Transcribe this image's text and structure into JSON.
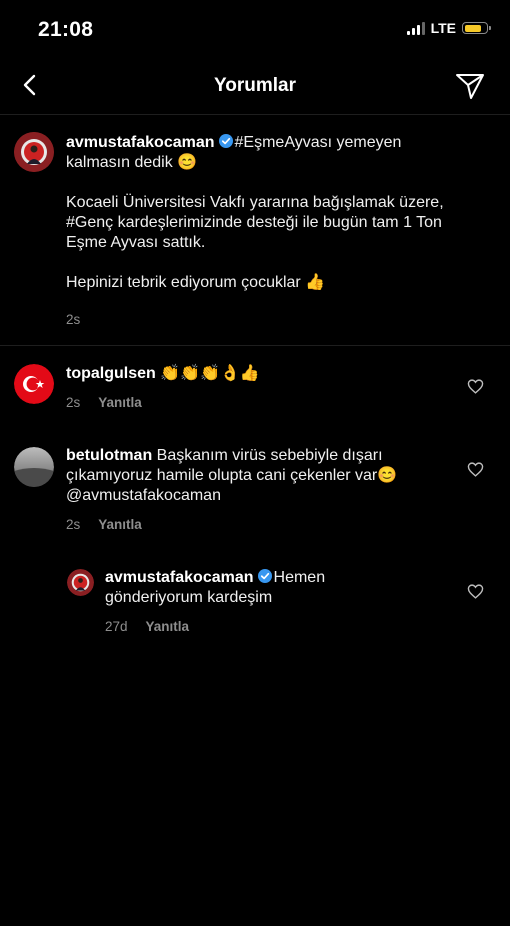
{
  "status_bar": {
    "time": "21:08",
    "network": "LTE"
  },
  "header": {
    "title": "Yorumlar"
  },
  "caption": {
    "username": "avmustafakocaman",
    "line1_rest": "#EşmeAyvası yemeyen",
    "line2": "kalmasın dedik 😊",
    "para2_line1": "Kocaeli Üniversitesi Vakfı yararına bağışlamak üzere,",
    "para2_line2": "#Genç kardeşlerimizinde desteği ile bugün tam 1 Ton",
    "para2_line3": "Eşme Ayvası sattık.",
    "para3": "Hepinizi tebrik ediyorum çocuklar 👍",
    "time": "2s"
  },
  "comments": [
    {
      "username": "topalgulsen",
      "text": "👏👏👏👌👍",
      "time": "2s",
      "reply_label": "Yanıtla"
    },
    {
      "username": "betulotman",
      "line1_rest": "Başkanım virüs sebebiyle dışarı",
      "line2": "çıkamıyoruz hamile olupta cani çekenler var😊",
      "line3": "@avmustafakocaman",
      "time": "2s",
      "reply_label": "Yanıtla"
    }
  ],
  "reply": {
    "username": "avmustafakocaman",
    "line1_rest": "Hemen",
    "line2": "gönderiyorum kardeşim",
    "time": "27d",
    "reply_label": "Yanıtla"
  },
  "colors": {
    "verified_badge": "#3897f0",
    "battery": "#f6c928",
    "muted_text": "#8e8e8e"
  }
}
